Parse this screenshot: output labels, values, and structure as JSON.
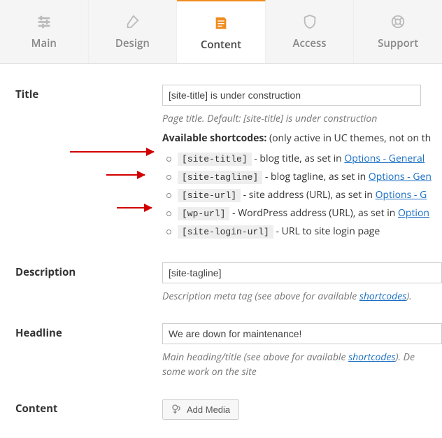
{
  "tabs": {
    "main": {
      "label": "Main"
    },
    "design": {
      "label": "Design"
    },
    "content": {
      "label": "Content"
    },
    "access": {
      "label": "Access"
    },
    "support": {
      "label": "Support"
    }
  },
  "title": {
    "label": "Title",
    "value": "[site-title] is under construction",
    "hint": "Page title. Default: [site-title] is under construction",
    "avail_label": "Available shortcodes:",
    "avail_note": " (only active in UC themes, not on th",
    "shortcodes": [
      {
        "code": "[site-title]",
        "desc": "  - blog title, as set in ",
        "link": "Options - General"
      },
      {
        "code": "[site-tagline]",
        "desc": "  - blog tagline, as set in ",
        "link": "Options - Gen"
      },
      {
        "code": "[site-url]",
        "desc": "  - site address (URL), as set in ",
        "link": "Options - G"
      },
      {
        "code": "[wp-url]",
        "desc": "  - WordPress address (URL), as set in ",
        "link": "Option"
      },
      {
        "code": "[site-login-url]",
        "desc": "  - URL to site login page",
        "link": ""
      }
    ]
  },
  "description": {
    "label": "Description",
    "value": "[site-tagline]",
    "hint_pre": "Description meta tag (see above for available ",
    "hint_link": "shortcodes",
    "hint_post": ")."
  },
  "headline": {
    "label": "Headline",
    "value": "We are down for maintenance!",
    "hint_pre": "Main heading/title (see above for available ",
    "hint_link": "shortcodes",
    "hint_post": "). De",
    "hint_line2": "some work on the site"
  },
  "content": {
    "label": "Content",
    "add_media": "Add Media"
  }
}
